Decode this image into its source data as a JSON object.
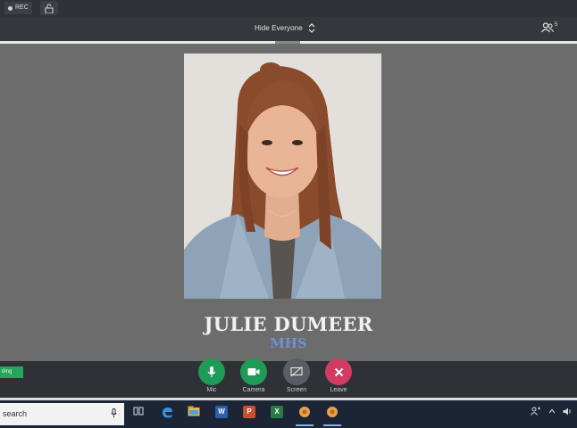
{
  "topbar": {
    "rec_label": "REC"
  },
  "subbar": {
    "hide_label": "Hide Everyone",
    "people_count": "5"
  },
  "stage": {
    "name": "JULIE DUMEER",
    "org": "MHS"
  },
  "controls": {
    "status_text": "ding",
    "mic_label": "Mic",
    "camera_label": "Camera",
    "screen_label": "Screen",
    "leave_label": "Leave"
  },
  "taskbar": {
    "search_placeholder": "search",
    "apps": [
      "task-view",
      "edge",
      "file-explorer",
      "word",
      "powerpoint",
      "excel",
      "app-orange-1",
      "app-orange-2"
    ]
  },
  "colors": {
    "stage_bg": "#6c6c6c",
    "mic_green": "#1f9a57",
    "leave_red": "#d23c63",
    "org_blue": "#6f8fd8"
  }
}
